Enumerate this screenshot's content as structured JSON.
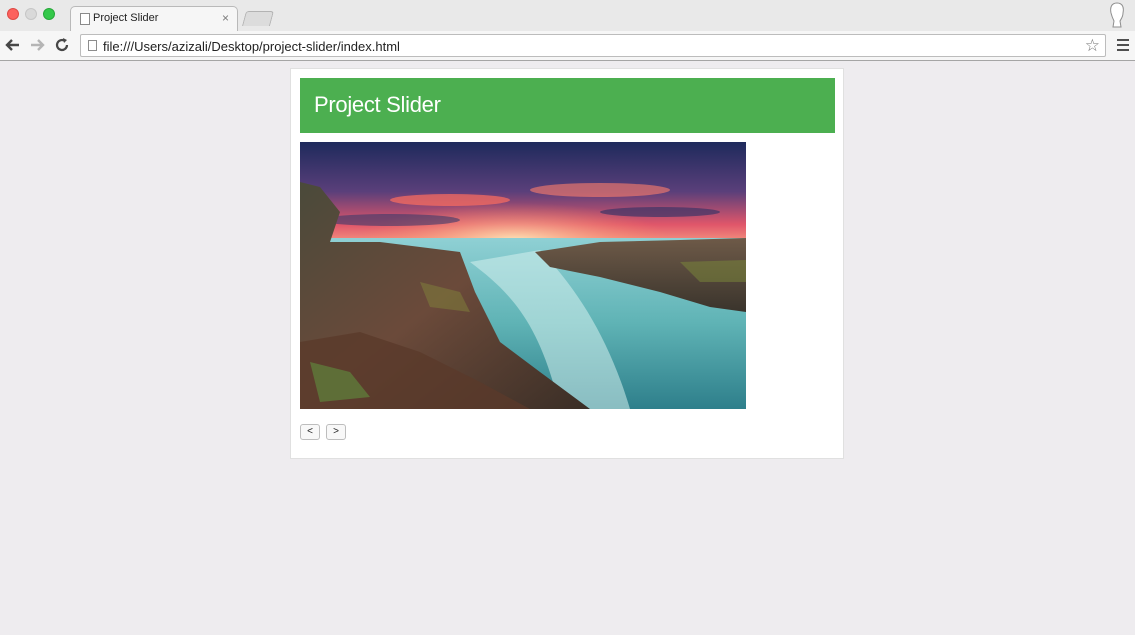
{
  "browser": {
    "tab_title": "Project Slider",
    "tab_close": "×",
    "url": "file:///Users/azizali/Desktop/project-slider/index.html",
    "icons": {
      "back": "back-arrow-icon",
      "forward": "forward-arrow-icon",
      "reload": "reload-icon",
      "bookmark": "star-icon",
      "menu": "hamburger-menu-icon"
    }
  },
  "page": {
    "title": "Project Slider",
    "accent_color": "#4caf50",
    "controls": {
      "prev_label": "<",
      "next_label": ">"
    }
  }
}
